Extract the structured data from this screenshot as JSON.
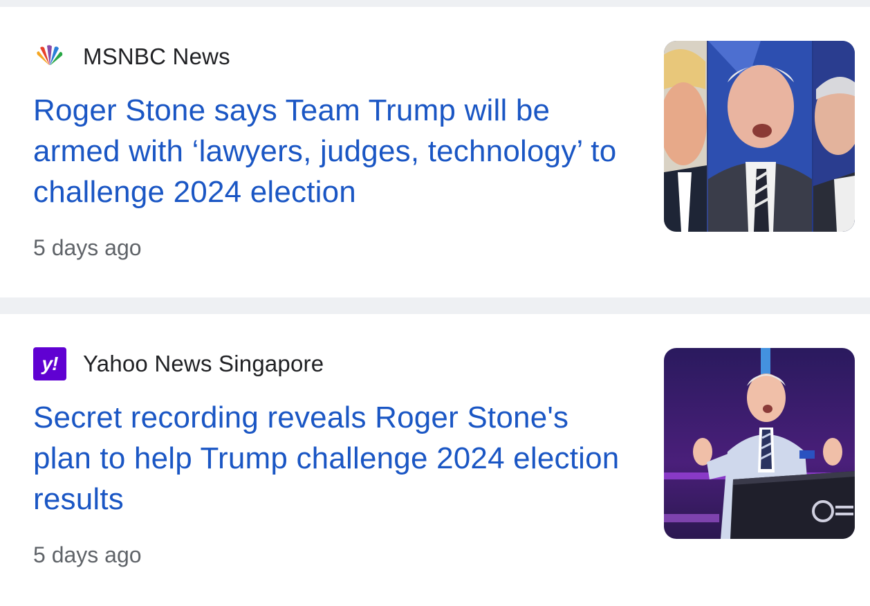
{
  "articles": [
    {
      "source": "MSNBC News",
      "source_logo": "nbc-peacock-icon",
      "headline": "Roger Stone says Team Trump will be armed with ‘lawyers, judges, technology’ to challenge 2024 election",
      "time": "5 days ago",
      "thumbnail": "roger-stone-trump-collage"
    },
    {
      "source": "Yahoo News Singapore",
      "source_logo": "yahoo-logo-icon",
      "source_logo_text": "y!",
      "headline": "Secret recording reveals Roger Stone's plan to help Trump challenge 2024 election results",
      "time": "5 days ago",
      "thumbnail": "roger-stone-speaking-at-podium"
    }
  ],
  "colors": {
    "headline": "#1a56c4",
    "source_text": "#202124",
    "time_text": "#5f6368",
    "background": "#eef0f3",
    "card": "#ffffff",
    "yahoo_purple": "#6001d2"
  }
}
